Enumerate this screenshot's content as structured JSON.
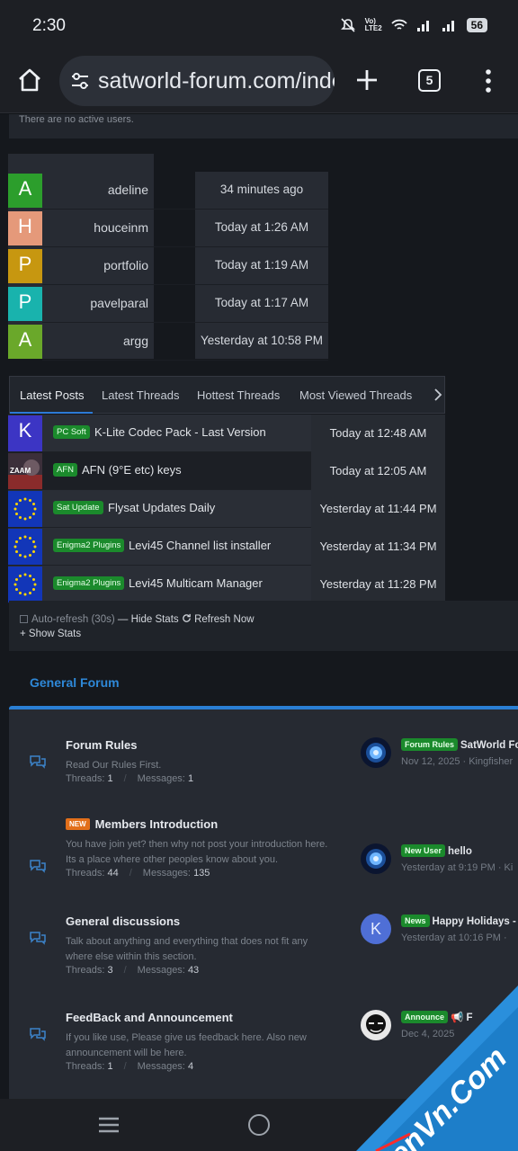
{
  "status_bar": {
    "time": "2:30",
    "lte_top": "Vo)",
    "lte_bottom": "LTE2",
    "battery": "56"
  },
  "browser": {
    "url": "satworld-forum.com/index.php",
    "tab_count": "5"
  },
  "online": {
    "message": "There are no active users."
  },
  "recent_users": [
    {
      "initial": "A",
      "name": "adeline",
      "time": "34 minutes ago",
      "color": "#2c9e2c"
    },
    {
      "initial": "H",
      "name": "houceinm",
      "time": "Today at 1:26 AM",
      "color": "#e5997a"
    },
    {
      "initial": "P",
      "name": "portfolio",
      "time": "Today at 1:19 AM",
      "color": "#c79710"
    },
    {
      "initial": "P",
      "name": "pavelparal",
      "time": "Today at 1:17 AM",
      "color": "#19b3ad"
    },
    {
      "initial": "A",
      "name": "argg",
      "time": "Yesterday at 10:58 PM",
      "color": "#6aa82a"
    }
  ],
  "post_tabs": [
    "Latest Posts",
    "Latest Threads",
    "Hottest Threads",
    "Most Viewed Threads"
  ],
  "posts": [
    {
      "avatar": "K",
      "avatar_type": "letter",
      "label": "PC Soft",
      "title": "K-Lite Codec Pack - Last Version",
      "time": "Today at 12:48 AM"
    },
    {
      "avatar": "ZAAM",
      "avatar_type": "image",
      "label": "AFN",
      "title": "AFN (9°E etc) keys",
      "time": "Today at 12:05 AM"
    },
    {
      "avatar": "eu",
      "avatar_type": "flag",
      "label": "Sat Update",
      "title": "Flysat Updates Daily",
      "time": "Yesterday at 11:44 PM"
    },
    {
      "avatar": "eu",
      "avatar_type": "flag",
      "label": "Enigma2 Plugins",
      "title": "Levi45 Channel list installer",
      "time": "Yesterday at 11:34 PM"
    },
    {
      "avatar": "eu",
      "avatar_type": "flag",
      "label": "Enigma2 Plugins",
      "title": "Levi45 Multicam Manager",
      "time": "Yesterday at 11:28 PM"
    }
  ],
  "stats_controls": {
    "auto_refresh": "Auto-refresh (30s)",
    "hide_stats": "Hide Stats",
    "refresh_now": "Refresh Now",
    "show_stats": "Show Stats"
  },
  "section": {
    "title": "General Forum"
  },
  "forums": [
    {
      "title": "Forum Rules",
      "is_new": false,
      "new_label": "",
      "desc": "Read Our Rules First.",
      "threads": "1",
      "messages": "1",
      "latest_tag": "Forum Rules",
      "latest_title": "SatWorld Fo",
      "latest_meta": "Nov 12, 2025 · Kingfisher"
    },
    {
      "title": "Members Introduction",
      "is_new": true,
      "new_label": "NEW",
      "desc": "You have join yet? then why not post your introduction here. Its a place where other peoples know about you.",
      "threads": "44",
      "messages": "135",
      "latest_tag": "New User",
      "latest_title": "hello",
      "latest_meta": "Yesterday at 9:19 PM · Ki"
    },
    {
      "title": "General discussions",
      "is_new": false,
      "new_label": "",
      "desc": "Talk about anything and everything that does not fit any where else within this section.",
      "threads": "3",
      "messages": "43",
      "latest_tag": "News",
      "latest_title": "Happy Holidays -",
      "latest_meta": "Yesterday at 10:16 PM · ",
      "latest_avatar": "K"
    },
    {
      "title": "FeedBack and Announcement",
      "is_new": false,
      "new_label": "",
      "desc": "If you like use, Please give us feedback here. Also new announcement will be here.",
      "threads": "1",
      "messages": "4",
      "latest_tag": "Announce",
      "latest_title": "📢 F",
      "latest_meta": "Dec 4, 2025"
    }
  ],
  "labels": {
    "threads": "Threads:",
    "messages": "Messages:"
  },
  "watermark": "XenVn.Com"
}
